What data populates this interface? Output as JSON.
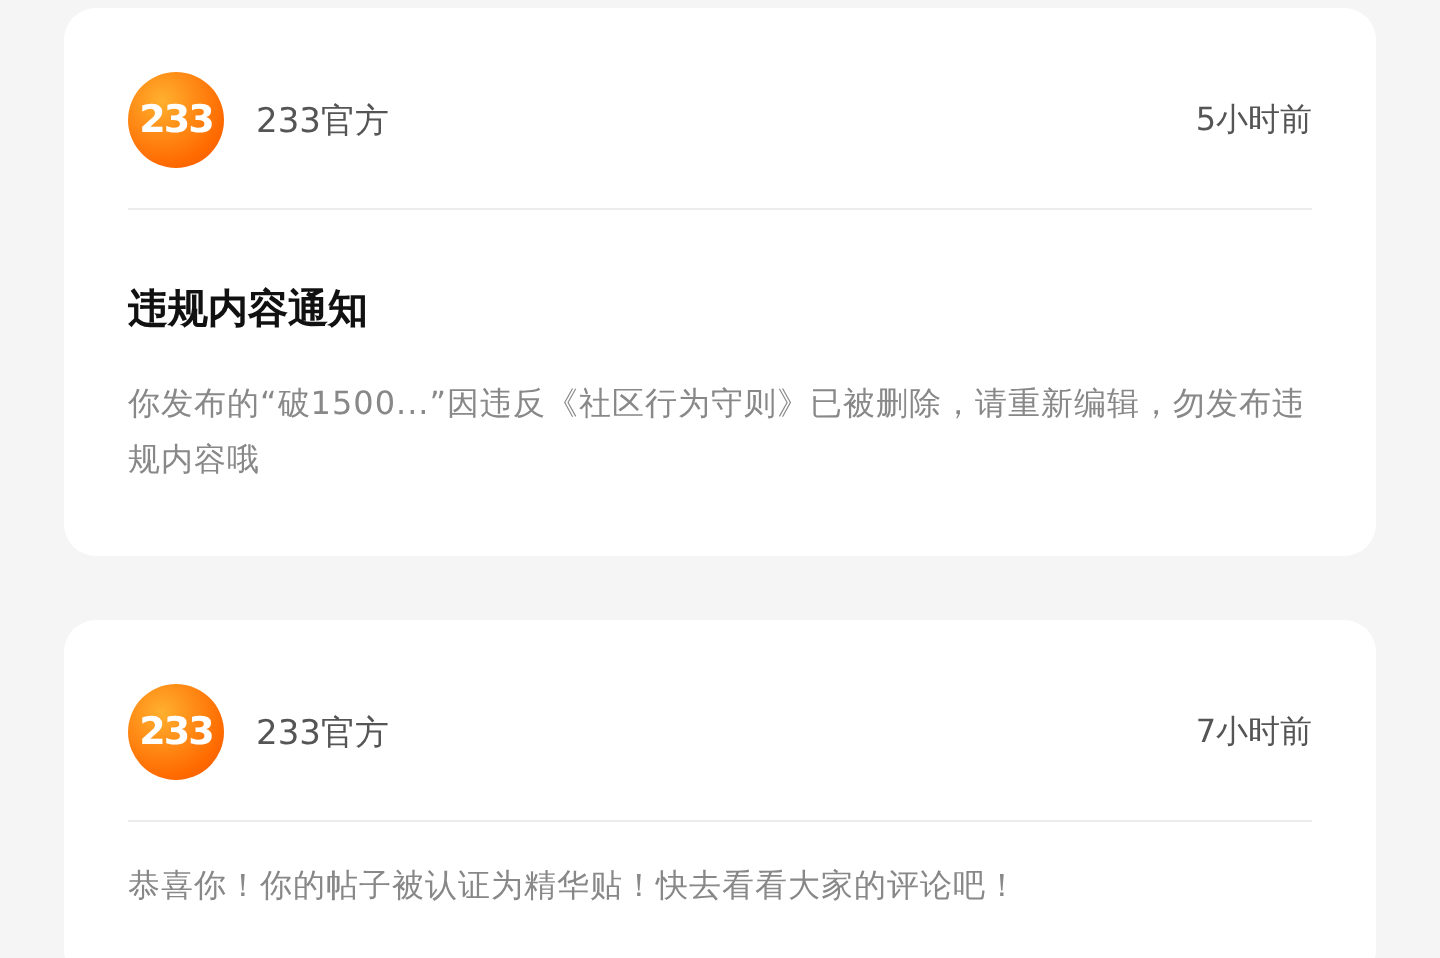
{
  "notifications": [
    {
      "logo_text": "233",
      "sender": "233官方",
      "time": "5小时前",
      "title": "违规内容通知",
      "body": "你发布的“破1500...”因违反《社区行为守则》已被删除，请重新编辑，勿发布违规内容哦"
    },
    {
      "logo_text": "233",
      "sender": "233官方",
      "time": "7小时前",
      "body": "恭喜你！你的帖子被认证为精华贴！快去看看大家的评论吧！"
    }
  ]
}
